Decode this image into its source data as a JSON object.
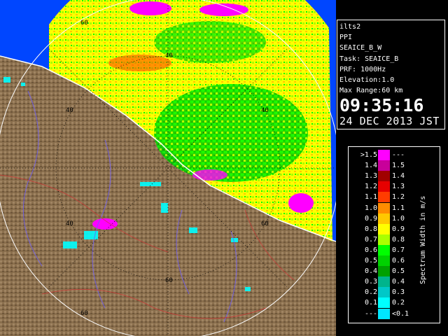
{
  "info_panel": {
    "lines": [
      "ilts2",
      "PPI",
      "SEAICE_B_W",
      "Task: SEAICE_B",
      "PRF: 1000Hz",
      "Elevation:1.0",
      "Max Range:60 km"
    ],
    "time": "09:35:16",
    "date": "24 DEC 2013 JST"
  },
  "legend": {
    "title": "Spectrum Width in m/s",
    "rows": [
      {
        "lo": ">1.5",
        "hi": "---",
        "color": "#ff00ff"
      },
      {
        "lo": "1.4",
        "hi": "1.5",
        "color": "#c8009a"
      },
      {
        "lo": "1.3",
        "hi": "1.4",
        "color": "#a00000"
      },
      {
        "lo": "1.2",
        "hi": "1.3",
        "color": "#e60000"
      },
      {
        "lo": "1.1",
        "hi": "1.2",
        "color": "#ff3c00"
      },
      {
        "lo": "1.0",
        "hi": "1.1",
        "color": "#ff8c00"
      },
      {
        "lo": "0.9",
        "hi": "1.0",
        "color": "#ffc800"
      },
      {
        "lo": "0.8",
        "hi": "0.9",
        "color": "#ffff00"
      },
      {
        "lo": "0.7",
        "hi": "0.8",
        "color": "#aaff00"
      },
      {
        "lo": "0.6",
        "hi": "0.7",
        "color": "#00ff00"
      },
      {
        "lo": "0.5",
        "hi": "0.6",
        "color": "#00d200"
      },
      {
        "lo": "0.4",
        "hi": "0.5",
        "color": "#00a000"
      },
      {
        "lo": "0.3",
        "hi": "0.4",
        "color": "#00b48c"
      },
      {
        "lo": "0.2",
        "hi": "0.3",
        "color": "#00c8c8"
      },
      {
        "lo": "0.1",
        "hi": "0.2",
        "color": "#00ffff"
      },
      {
        "lo": "---",
        "hi": "<0.1",
        "color": "#00e6ff"
      }
    ]
  },
  "map": {
    "range_ring_labels": [
      "40",
      "40",
      "40",
      "40",
      "60",
      "60",
      "60",
      "60"
    ],
    "colors": {
      "sea": "#0046ff",
      "land": "#8c7250",
      "outline": "#ffffff"
    }
  }
}
